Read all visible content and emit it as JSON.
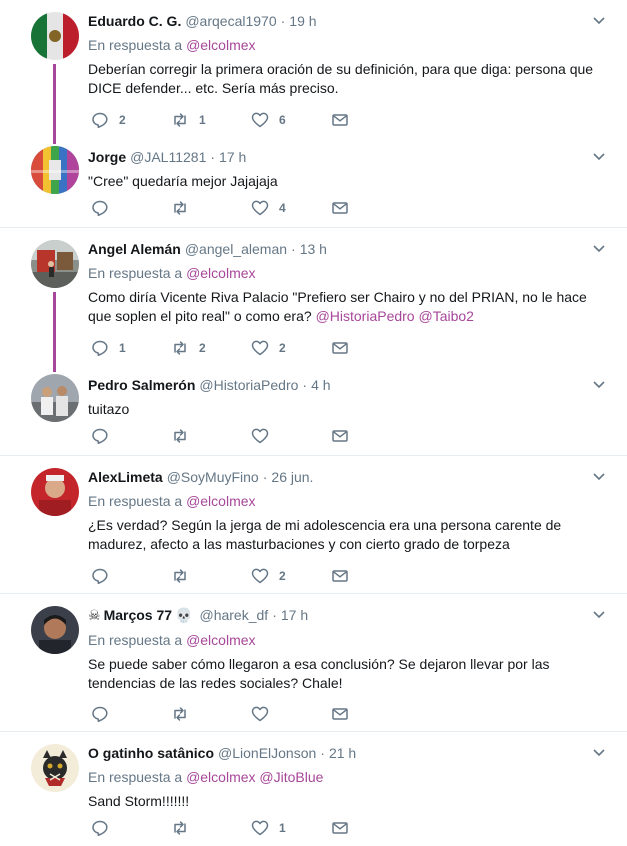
{
  "reply_prefix": "En respuesta a",
  "tweets": [
    {
      "name": "Eduardo C. G.",
      "handle": "@arqecal1970",
      "time": "19 h",
      "reply_to": [
        "@elcolmex"
      ],
      "text_lines": [
        "Deberían corregir la primera oración de su definición, para que diga: persona que",
        "DICE defender... etc. Sería más preciso."
      ],
      "replies": "2",
      "retweets": "1",
      "likes": "6",
      "avatar": "mexican-flag"
    },
    {
      "name": "Jorge",
      "handle": "@JAL11281",
      "time": "17 h",
      "text_lines": [
        "\"Cree\" quedaría mejor Jajajaja"
      ],
      "replies": "",
      "retweets": "",
      "likes": "4",
      "avatar": "colorful-corridor"
    },
    {
      "name": "Angel Alemán",
      "handle": "@angel_aleman",
      "time": "13 h",
      "reply_to": [
        "@elcolmex"
      ],
      "text_line1": "Como diría Vicente Riva Palacio \"Prefiero ser Chairo y no del PRIAN, no le hace",
      "text_line2_plain": "que soplen el pito real\" o como era? ",
      "mention1": "@HistoriaPedro",
      "mention2": "@Taibo2",
      "replies": "1",
      "retweets": "2",
      "likes": "2",
      "avatar": "street-photo"
    },
    {
      "name": "Pedro Salmerón",
      "handle": "@HistoriaPedro",
      "time": "4 h",
      "text_lines": [
        "tuitazo"
      ],
      "replies": "",
      "retweets": "",
      "likes": "",
      "avatar": "people-photo"
    },
    {
      "name": "AlexLimeta",
      "handle": "@SoyMuyFino",
      "time": "26 jun.",
      "reply_to": [
        "@elcolmex"
      ],
      "text_lines": [
        "¿Es verdad? Según la jerga de mi adolescencia era una persona carente de",
        "madurez, afecto a las masturbaciones y con cierto grado de torpeza"
      ],
      "replies": "",
      "retweets": "",
      "likes": "2",
      "avatar": "man-red-background"
    },
    {
      "name": "Marços 77",
      "name_prefix_emoji": "☠",
      "name_suffix_emoji": "💀",
      "handle": "@harek_df",
      "time": "17 h",
      "reply_to": [
        "@elcolmex"
      ],
      "text_lines": [
        "Se puede saber cómo llegaron a esa conclusión? Se dejaron llevar por las",
        "tendencias de las redes sociales? Chale!"
      ],
      "replies": "",
      "retweets": "",
      "likes": "",
      "avatar": "young-man"
    },
    {
      "name": "O gatinho satânico",
      "handle": "@LionElJonson",
      "time": "21 h",
      "reply_to": [
        "@elcolmex",
        "@JitoBlue"
      ],
      "text_lines": [
        "Sand Storm!!!!!!!"
      ],
      "replies": "",
      "retweets": "",
      "likes": "1",
      "avatar": "cat-emblem"
    }
  ],
  "colors": {
    "link": "#a7479a",
    "muted": "#657786",
    "text": "#14171a",
    "divider": "#e6ecf0"
  },
  "icons": [
    "reply-icon",
    "retweet-icon",
    "like-icon",
    "direct-message-icon",
    "chevron-down-icon"
  ]
}
